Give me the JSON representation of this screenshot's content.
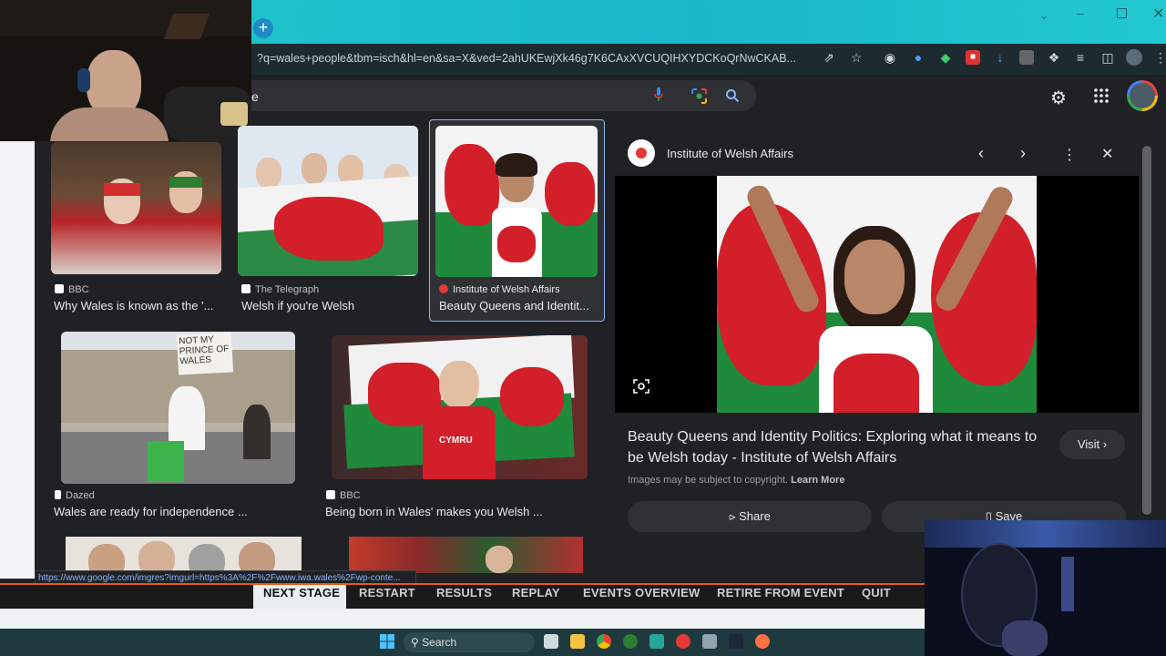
{
  "browser": {
    "url": "?q=wales+people&tbm=isch&hl=en&sa=X&ved=2ahUKEwjXk46g7K6CAxXVCUQIHXYDCKoQrNwCKAB...",
    "new_tab_glyph": "+",
    "status_url": "https://www.google.com/imgres?imgurl=https%3A%2F%2Fwww.iwa.wales%2Fwp-conte..."
  },
  "search": {
    "query": "e"
  },
  "results": [
    {
      "source": "BBC",
      "caption": "Why Wales is known as the '...",
      "favicon_color": "#ffffff"
    },
    {
      "source": "The Telegraph",
      "caption": "Welsh if you're Welsh",
      "favicon_color": "#ffffff"
    },
    {
      "source": "Institute of Welsh Affairs",
      "caption": "Beauty Queens and Identit...",
      "favicon_color": "#e53935"
    },
    {
      "source": "Dazed",
      "caption": "Wales are ready for independence ...",
      "favicon_color": "#ffffff"
    },
    {
      "source": "BBC",
      "caption": "Being born in Wales' makes you Welsh ...",
      "favicon_color": "#ffffff"
    }
  ],
  "sign_text": "NOT MY PRINCE OF WALES",
  "shirt_text": "CYMRU",
  "panel": {
    "site": "Institute of Welsh Affairs",
    "title": "Beauty Queens and Identity Politics: Exploring what it means to be Welsh today - Institute of Welsh Affairs",
    "visit_label": "Visit",
    "copyright": "Images may be subject to copyright.",
    "learn_more": "Learn More",
    "share_label": "Share",
    "save_label": "Save"
  },
  "game_menu": [
    "NEXT STAGE",
    "RESTART",
    "RESULTS",
    "REPLAY",
    "EVENTS OVERVIEW",
    "RETIRE FROM EVENT",
    "QUIT"
  ],
  "taskbar": {
    "search_label": "Search"
  },
  "colors": {
    "accent_orange": "#e85a10",
    "welsh_red": "#d21f2a",
    "welsh_green": "#1f8a3b",
    "link_blue": "#8ab4f8"
  }
}
